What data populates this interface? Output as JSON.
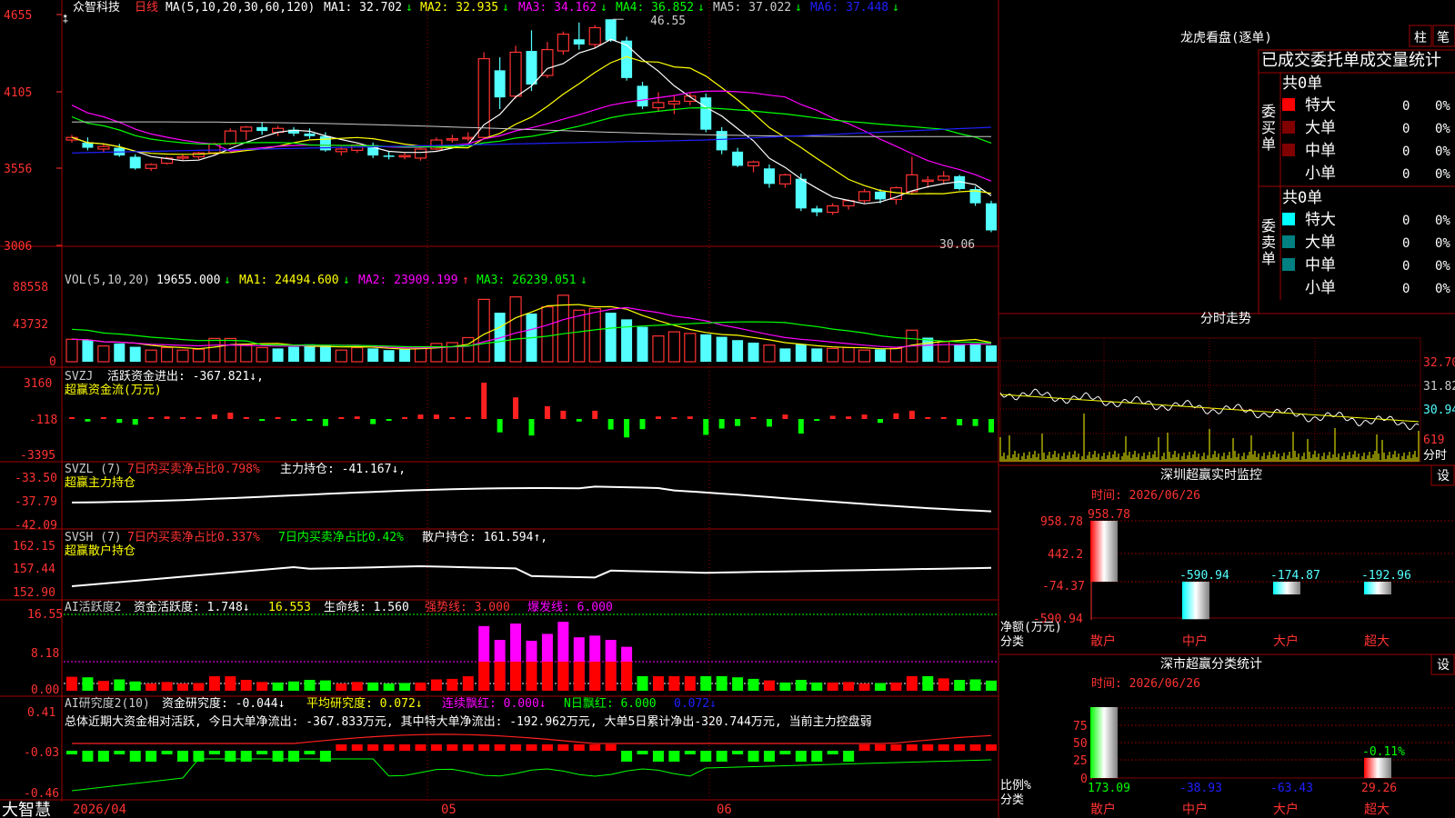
{
  "header": {
    "star": "★",
    "stock_name": "众智科技",
    "period": "日线",
    "ma_params": "MA(5,10,20,30,60,120)",
    "ma_values": [
      {
        "label": "MA1: 32.702",
        "arrow": "↓",
        "color": "#ffffff"
      },
      {
        "label": "MA2: 32.935",
        "arrow": "↓",
        "color": "#ffff00"
      },
      {
        "label": "MA3: 34.162",
        "arrow": "↓",
        "color": "#ff00ff"
      },
      {
        "label": "MA4: 36.852",
        "arrow": "↓",
        "color": "#00ff00"
      },
      {
        "label": "MA5: 37.022",
        "arrow": "↓",
        "color": "#cccccc"
      },
      {
        "label": "MA6: 37.448",
        "arrow": "↓",
        "color": "#2020ff"
      }
    ],
    "max_label": "46.55",
    "min_label": "30.06"
  },
  "price_axis": [
    "4655",
    "4105",
    "3556",
    "3006"
  ],
  "vol_panel": {
    "title": "VOL(5,10,20)",
    "values": [
      {
        "label": "19655.000",
        "arrow": "↓",
        "color": "#ffffff"
      },
      {
        "label": "MA1: 24494.600",
        "arrow": "↓",
        "color": "#ffff00"
      },
      {
        "label": "MA2: 23909.199",
        "arrow": "↑",
        "color": "#ff00ff"
      },
      {
        "label": "MA3: 26239.051",
        "arrow": "↓",
        "color": "#00ff00"
      }
    ],
    "axis": [
      "88558",
      "43732",
      "0"
    ]
  },
  "svzj_panel": {
    "title": "SVZJ",
    "line1": "活跃资金进出: -367.821↓,",
    "line2": "超赢资金流(万元)",
    "axis": [
      "3160",
      "-118",
      "-3395"
    ]
  },
  "svzl_panel": {
    "title": "SVZL (7)",
    "part1": "7日内买卖净占比0.798%",
    "part2": "主力持仓: -41.167↓,",
    "line2": "超赢主力持仓",
    "axis": [
      "-33.50",
      "-37.79",
      "-42.09"
    ]
  },
  "svsh_panel": {
    "title": "SVSH (7)",
    "part1": "7日内买卖净占比0.337%",
    "part2": "7日内买卖净占比0.42%",
    "part3": "散户持仓: 161.594↑,",
    "line2": "超赢散户持仓",
    "axis": [
      "162.15",
      "157.44",
      "152.90"
    ]
  },
  "ai_active_panel": {
    "title": "AI活跃度2",
    "part1": "资金活跃度: 1.748↓",
    "part2": "16.553",
    "part3": "生命线: 1.560",
    "part4": "强势线: 3.000",
    "part5": "爆发线: 6.000",
    "axis": [
      "16.55",
      "8.18",
      "0.00"
    ]
  },
  "ai_research_panel": {
    "title": "AI研究度2(10)",
    "part1": "资金研究度: -0.044↓",
    "part2": "平均研究度: 0.072↓",
    "part3": "连续飘红: 0.000↓",
    "part4": "N日飘红: 6.000",
    "part5": "0.072↓",
    "summary": "总体近期大资金相对活跃, 今日大单净流出: -367.833万元, 其中特大单净流出: -192.962万元, 大单5日累计净出-320.744万元, 当前主力控盘弱",
    "axis": [
      "0.41",
      "-0.03",
      "-0.46"
    ]
  },
  "bottom_bar": {
    "logo": "大智慧",
    "dates": [
      "2026/04",
      "05",
      "06"
    ]
  },
  "right_panel": {
    "dragon_title": "龙虎看盘(逐单)",
    "btn_zhu": "柱",
    "btn_bi": "笔",
    "order_stats_title": "已成交委托单成交量统计",
    "buy_side_label": "委买单",
    "sell_side_label": "委卖单",
    "buy_total": "共0单",
    "sell_total": "共0单",
    "buy_rows": [
      {
        "name": "特大",
        "count": "0",
        "pct": "0%",
        "color": "#ff0000"
      },
      {
        "name": "大单",
        "count": "0",
        "pct": "0%",
        "color": "#800000"
      },
      {
        "name": "中单",
        "count": "0",
        "pct": "0%",
        "color": "#800000"
      },
      {
        "name": "小单",
        "count": "0",
        "pct": "0%",
        "color": ""
      }
    ],
    "sell_rows": [
      {
        "name": "特大",
        "count": "0",
        "pct": "0%",
        "color": "#00ffff"
      },
      {
        "name": "大单",
        "count": "0",
        "pct": "0%",
        "color": "#008080"
      },
      {
        "name": "中单",
        "count": "0",
        "pct": "0%",
        "color": "#008080"
      },
      {
        "name": "小单",
        "count": "0",
        "pct": "0%",
        "color": ""
      }
    ],
    "intraday_title": "分时走势",
    "intraday_axis": [
      "32.70",
      "31.82",
      "30.94"
    ],
    "intraday_vol": "619",
    "intraday_vol_label": "分时",
    "sz_monitor_title": "深圳超赢实时监控",
    "set_label": "设",
    "monitor_time": "时间: 2026/06/26",
    "monitor_axis": [
      "958.78",
      "442.2",
      "-74.37",
      "-590.94"
    ],
    "monitor_axis_label1": "净额(万元)",
    "monitor_axis_label2": "分类",
    "monitor_bars": [
      {
        "name": "散户",
        "value": 958.78,
        "label": "958.78"
      },
      {
        "name": "中户",
        "value": -590.94,
        "label": "-590.94"
      },
      {
        "name": "大户",
        "value": -174.87,
        "label": "-174.87"
      },
      {
        "name": "超大",
        "value": -192.96,
        "label": "-192.96"
      }
    ],
    "class_title": "深市超赢分类统计",
    "class_time": "时间: 2026/06/26",
    "class_axis": [
      "75",
      "50",
      "25",
      "0"
    ],
    "class_axis_label1": "比例%",
    "class_axis_label2": "分类",
    "class_bars": [
      {
        "name": "散户",
        "value": 173.09,
        "label": "173.09"
      },
      {
        "name": "中户",
        "value": -38.93,
        "label": "-38.93"
      },
      {
        "name": "大户",
        "value": -63.43,
        "label": "-63.43"
      },
      {
        "name": "超大",
        "value": 29.26,
        "label": "29.26"
      }
    ],
    "class_extra_label": "-0.11%"
  },
  "colors": {
    "up": "#ff3232",
    "down": "#54ffff",
    "grid": "#a00000",
    "axis_text": "#ff3232",
    "green": "#00ff00"
  },
  "chart_data": {
    "type": "candlestick",
    "candles": [
      [
        37.2,
        37.6,
        37.0,
        37.4
      ],
      [
        37.0,
        37.4,
        36.4,
        36.6
      ],
      [
        36.5,
        36.9,
        36.2,
        36.7
      ],
      [
        36.6,
        36.9,
        35.9,
        36.0
      ],
      [
        35.9,
        36.1,
        34.9,
        35.0
      ],
      [
        35.0,
        35.4,
        34.8,
        35.3
      ],
      [
        35.4,
        35.9,
        35.3,
        35.8
      ],
      [
        35.8,
        36.1,
        35.6,
        35.9
      ],
      [
        35.9,
        36.3,
        35.7,
        36.2
      ],
      [
        36.2,
        37.0,
        36.0,
        36.9
      ],
      [
        36.9,
        38.1,
        36.8,
        37.9
      ],
      [
        37.9,
        38.3,
        37.2,
        38.2
      ],
      [
        38.2,
        38.6,
        37.6,
        37.9
      ],
      [
        37.8,
        38.3,
        37.5,
        38.1
      ],
      [
        38.0,
        38.2,
        37.5,
        37.7
      ],
      [
        37.7,
        38.1,
        37.3,
        37.5
      ],
      [
        37.5,
        37.8,
        36.3,
        36.4
      ],
      [
        36.3,
        36.7,
        36.0,
        36.5
      ],
      [
        36.4,
        36.9,
        36.2,
        36.8
      ],
      [
        36.8,
        37.0,
        35.8,
        36.0
      ],
      [
        36.0,
        36.3,
        35.7,
        35.9
      ],
      [
        35.9,
        36.2,
        35.7,
        36.0
      ],
      [
        35.8,
        36.6,
        35.6,
        36.5
      ],
      [
        36.5,
        37.4,
        36.4,
        37.2
      ],
      [
        37.2,
        37.6,
        37.0,
        37.3
      ],
      [
        37.3,
        37.8,
        37.1,
        37.4
      ],
      [
        37.4,
        44.0,
        37.3,
        43.5
      ],
      [
        42.6,
        43.6,
        39.6,
        40.5
      ],
      [
        40.6,
        44.5,
        40.4,
        44.0
      ],
      [
        44.1,
        45.7,
        41.0,
        41.5
      ],
      [
        42.2,
        44.8,
        42.0,
        44.2
      ],
      [
        44.1,
        45.6,
        43.8,
        45.4
      ],
      [
        45.0,
        46.3,
        44.2,
        44.6
      ],
      [
        44.6,
        46.1,
        44.3,
        45.9
      ],
      [
        46.55,
        46.55,
        44.8,
        44.9
      ],
      [
        44.9,
        45.2,
        41.8,
        42.0
      ],
      [
        41.4,
        41.7,
        39.6,
        39.8
      ],
      [
        39.7,
        40.9,
        39.4,
        40.1
      ],
      [
        40.0,
        40.7,
        39.2,
        40.2
      ],
      [
        40.2,
        40.9,
        39.9,
        40.6
      ],
      [
        40.5,
        40.8,
        37.8,
        38.0
      ],
      [
        37.9,
        38.2,
        36.1,
        36.4
      ],
      [
        36.3,
        36.6,
        35.1,
        35.2
      ],
      [
        35.2,
        35.6,
        34.7,
        35.5
      ],
      [
        35.0,
        35.3,
        33.5,
        33.8
      ],
      [
        33.8,
        34.6,
        33.5,
        34.5
      ],
      [
        34.2,
        34.6,
        31.7,
        31.9
      ],
      [
        31.9,
        32.1,
        31.3,
        31.6
      ],
      [
        31.6,
        32.3,
        31.4,
        32.1
      ],
      [
        32.1,
        32.6,
        31.8,
        32.5
      ],
      [
        32.5,
        33.4,
        32.3,
        33.2
      ],
      [
        33.2,
        33.4,
        32.3,
        32.6
      ],
      [
        32.6,
        33.6,
        32.2,
        33.5
      ],
      [
        33.2,
        35.9,
        33.0,
        34.5
      ],
      [
        34.1,
        34.4,
        33.5,
        34.1
      ],
      [
        34.1,
        34.8,
        33.8,
        34.4
      ],
      [
        34.4,
        34.5,
        33.3,
        33.4
      ],
      [
        33.4,
        33.6,
        32.1,
        32.3
      ],
      [
        32.3,
        32.5,
        30.06,
        30.2
      ]
    ],
    "volume": [
      [
        27000,
        "u"
      ],
      [
        26000,
        "d"
      ],
      [
        19000,
        "u"
      ],
      [
        22000,
        "d"
      ],
      [
        18000,
        "d"
      ],
      [
        14000,
        "u"
      ],
      [
        17000,
        "u"
      ],
      [
        14000,
        "u"
      ],
      [
        15000,
        "u"
      ],
      [
        28000,
        "u"
      ],
      [
        28000,
        "u"
      ],
      [
        21000,
        "u"
      ],
      [
        17000,
        "u"
      ],
      [
        16000,
        "d"
      ],
      [
        18000,
        "d"
      ],
      [
        21000,
        "d"
      ],
      [
        20000,
        "d"
      ],
      [
        14000,
        "u"
      ],
      [
        17000,
        "u"
      ],
      [
        16000,
        "d"
      ],
      [
        14000,
        "d"
      ],
      [
        15000,
        "d"
      ],
      [
        16000,
        "u"
      ],
      [
        22000,
        "u"
      ],
      [
        23000,
        "u"
      ],
      [
        29000,
        "u"
      ],
      [
        75000,
        "u"
      ],
      [
        59000,
        "d"
      ],
      [
        78000,
        "u"
      ],
      [
        58000,
        "d"
      ],
      [
        66000,
        "u"
      ],
      [
        80000,
        "u"
      ],
      [
        62000,
        "u"
      ],
      [
        64000,
        "u"
      ],
      [
        59000,
        "d"
      ],
      [
        51000,
        "d"
      ],
      [
        42000,
        "d"
      ],
      [
        31000,
        "u"
      ],
      [
        36000,
        "u"
      ],
      [
        34000,
        "u"
      ],
      [
        33000,
        "d"
      ],
      [
        30000,
        "d"
      ],
      [
        26000,
        "d"
      ],
      [
        23000,
        "d"
      ],
      [
        20000,
        "u"
      ],
      [
        16000,
        "d"
      ],
      [
        21000,
        "d"
      ],
      [
        16000,
        "d"
      ],
      [
        16000,
        "u"
      ],
      [
        17000,
        "u"
      ],
      [
        14000,
        "u"
      ],
      [
        15000,
        "d"
      ],
      [
        16000,
        "u"
      ],
      [
        38000,
        "u"
      ],
      [
        29000,
        "d"
      ],
      [
        24000,
        "u"
      ],
      [
        21000,
        "d"
      ],
      [
        22000,
        "d"
      ],
      [
        19655,
        "d"
      ]
    ]
  }
}
